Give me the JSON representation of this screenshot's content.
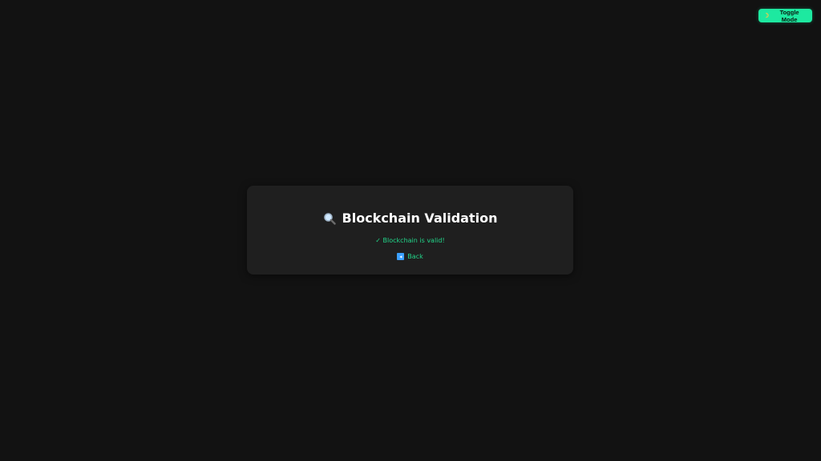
{
  "header": {
    "toggle_label": "Toggle Mode",
    "toggle_icon": "crescent-moon-icon"
  },
  "card": {
    "title_icon": "magnifying-glass-icon",
    "title": "Blockchain Validation",
    "status": "✓ Blockchain is valid!",
    "back_icon": "back-arrow-icon",
    "back_label": "Back"
  },
  "colors": {
    "background": "#121212",
    "card": "#1f1f1f",
    "accent": "#1de9a0",
    "status_green": "#22d68a"
  }
}
